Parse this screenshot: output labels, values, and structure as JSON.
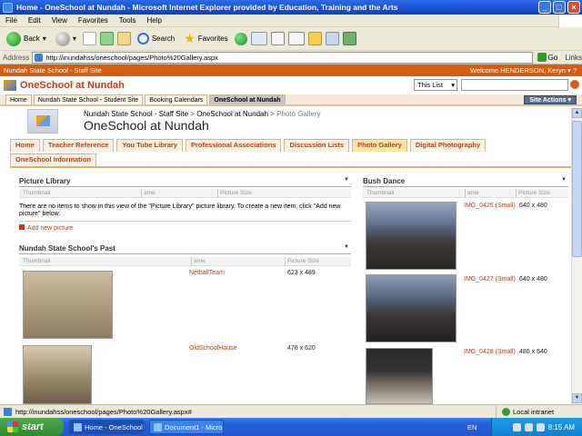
{
  "window": {
    "title": "Home - OneSchool at Nundah - Microsoft Internet Explorer provided by Education, Training and the Arts"
  },
  "menu": [
    "File",
    "Edit",
    "View",
    "Favorites",
    "Tools",
    "Help"
  ],
  "toolbar": {
    "back": "Back",
    "search": "Search",
    "favorites": "Favorites"
  },
  "address": {
    "label": "Address",
    "url": "http://inundahss/oneschool/pages/Photo%20Gallery.aspx",
    "go": "Go",
    "links": "Links"
  },
  "site": {
    "strip_label": "Nundah State School - Staff Site",
    "welcome": "Welcome HENDERSON, Keryn",
    "name": "OneSchool at Nundah",
    "search_scope": "This List"
  },
  "topnav": [
    "Home",
    "Nundah State School - Student Site",
    "Booking Calendars",
    "OneSchool at Nundah"
  ],
  "site_actions": "Site Actions",
  "breadcrumb": {
    "item1": "Nundah State School - Staff Site",
    "item2": "OneSchool at Nundah",
    "current": "Photo Gallery",
    "sep": ">"
  },
  "page_title": "OneSchool at Nundah",
  "tabs_row1": [
    "Home",
    "Teacher Reference",
    "You Tube Library",
    "Professional Associations",
    "Discussion Lists",
    "Photo Gallery",
    "Digital Photography"
  ],
  "tabs_row2": [
    "OneSchool Information"
  ],
  "picture_library": {
    "title": "Picture Library",
    "col_thumbnail": "Thumbnail",
    "col_name": "ame",
    "col_size": "Picture Size",
    "empty_message": "There are no items to show in this view of the \"Picture Library\" picture library. To create a new item, click \"Add new picture\" below.",
    "add_new": "Add new picture"
  },
  "past": {
    "title": "Nundah State School's Past",
    "col_thumbnail": "Thumbnail",
    "col_name": "ame",
    "col_size": "Picture Size",
    "rows": [
      {
        "name": "NetballTeam",
        "size": "623 x 489"
      },
      {
        "name": "OldSchoolHouse",
        "size": "478 x 620"
      }
    ]
  },
  "bush_dance": {
    "title": "Bush Dance",
    "col_thumbnail": "Thumbnail",
    "col_name": "ame",
    "col_size": "Picture Size",
    "rows": [
      {
        "name": "IMG_0426 (Small)",
        "size": "640 x 480"
      },
      {
        "name": "IMG_0427 (Small)",
        "size": "640 x 480"
      },
      {
        "name": "IMG_0428 (Small)",
        "size": "480 x 640"
      }
    ]
  },
  "status": {
    "url": "http://inundahss/oneschool/pages/Photo%20Gallery.aspx#",
    "zone": "Local intranet"
  },
  "taskbar": {
    "start": "start",
    "tasks": [
      "Home - OneSchool at ...",
      "Document1 - Microsof..."
    ],
    "lang": "EN",
    "clock": "8:15 AM"
  }
}
